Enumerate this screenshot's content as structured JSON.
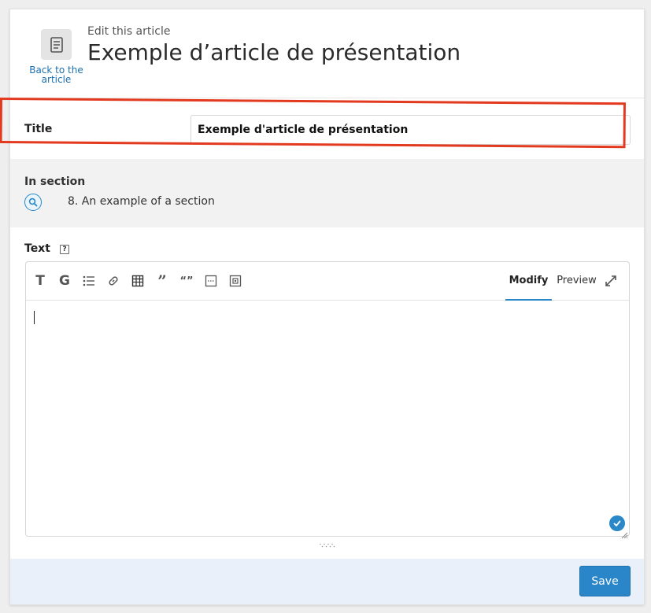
{
  "header": {
    "back_label": "Back to the article",
    "subtitle": "Edit this article",
    "title": "Exemple d’article de présentation"
  },
  "form": {
    "title_label": "Title",
    "title_value": "Exemple d'article de présentation",
    "section_label": "In section",
    "section_value": "8. An example of a section",
    "text_label": "Text",
    "text_help": "?"
  },
  "editor": {
    "toolbar": [
      {
        "name": "heading-icon",
        "glyph": "T"
      },
      {
        "name": "bold-icon",
        "glyph": "G"
      },
      {
        "name": "list-icon",
        "glyph": "list"
      },
      {
        "name": "link-icon",
        "glyph": "link"
      },
      {
        "name": "table-icon",
        "glyph": "table"
      },
      {
        "name": "quote-icon",
        "glyph": "quote"
      },
      {
        "name": "inline-quote-icon",
        "glyph": "inline-quote"
      },
      {
        "name": "code-block-icon",
        "glyph": "code"
      },
      {
        "name": "media-icon",
        "glyph": "media"
      }
    ],
    "tab_modify": "Modify",
    "tab_preview": "Preview",
    "content": ""
  },
  "footer": {
    "save_label": "Save"
  },
  "colors": {
    "accent": "#2a86c9",
    "highlight": "#e33a1f",
    "section_bg": "#f2f2f2",
    "footer_bg": "#e9f0f9",
    "link": "#1b6fae"
  }
}
